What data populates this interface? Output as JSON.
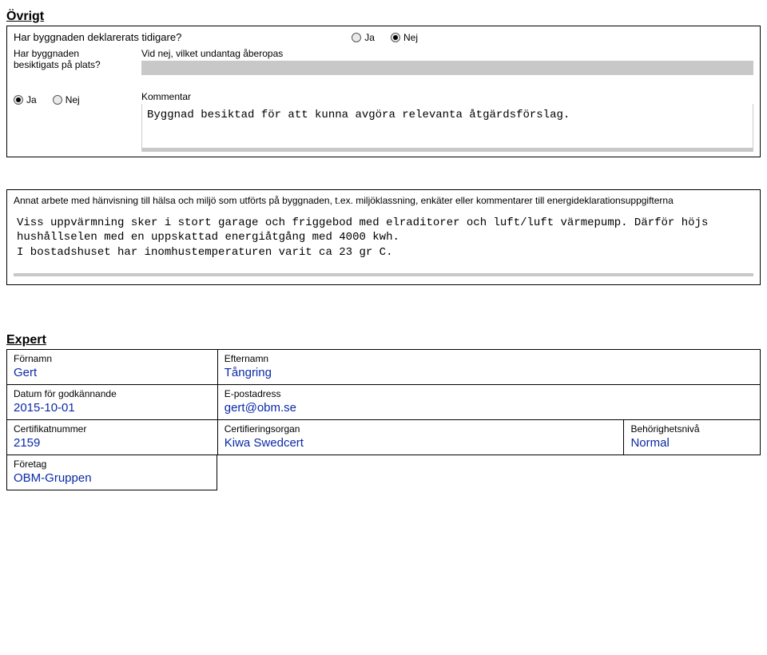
{
  "ovrigt": {
    "title": "Övrigt",
    "q1": {
      "text": "Har byggnaden deklarerats tidigare?",
      "ja": "Ja",
      "nej": "Nej",
      "selected": "nej"
    },
    "q2": {
      "left_label": "Har byggnaden besiktigats på plats?",
      "right_label": "Vid nej, vilket undantag åberopas",
      "value": ""
    },
    "q3": {
      "ja": "Ja",
      "nej": "Nej",
      "selected": "ja",
      "kommentar_label": "Kommentar",
      "kommentar_text": "Byggnad besiktad för att kunna avgöra relevanta åtgärdsförslag."
    }
  },
  "annat": {
    "label": "Annat arbete med hänvisning till hälsa och miljö som utförts på byggnaden, t.ex. miljöklassning, enkäter eller kommentarer till energideklarationsuppgifterna",
    "text": "Viss uppvärmning sker i stort garage och friggebod med elraditorer och luft/luft värmepump. Därför höjs hushållselen med en uppskattad energiåtgång med 4000 kwh.\nI bostadshuset har inomhustemperaturen varit ca 23 gr C."
  },
  "expert": {
    "title": "Expert",
    "fornamn_label": "Förnamn",
    "fornamn": "Gert",
    "efternamn_label": "Efternamn",
    "efternamn": "Tångring",
    "datum_label": "Datum för godkännande",
    "datum": "2015-10-01",
    "epost_label": "E-postadress",
    "epost": "gert@obm.se",
    "cert_label": "Certifikatnummer",
    "cert": "2159",
    "organ_label": "Certifieringsorgan",
    "organ": "Kiwa Swedcert",
    "niv_label": "Behörighetsnivå",
    "niv": "Normal",
    "foretag_label": "Företag",
    "foretag": "OBM-Gruppen"
  }
}
